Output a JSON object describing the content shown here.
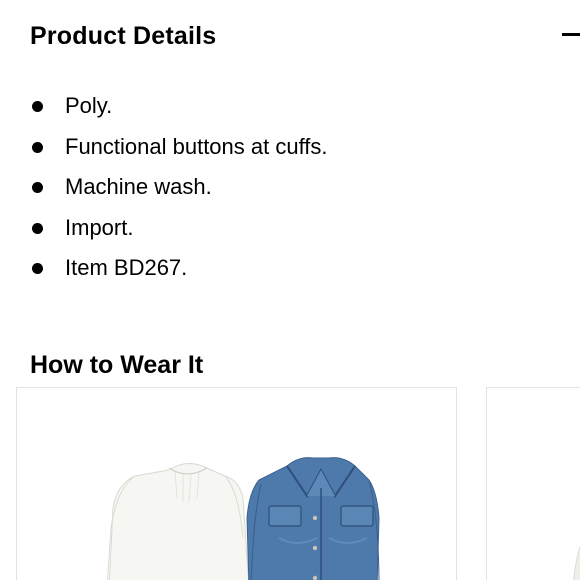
{
  "product_details": {
    "title": "Product Details",
    "toggle_icon": "minus-icon",
    "items": [
      "Poly.",
      "Functional buttons at cuffs.",
      "Machine wash.",
      "Import.",
      "Item BD267."
    ]
  },
  "how_to_wear": {
    "title": "How to Wear It",
    "cards": [
      {
        "items": [
          "white-blouse-image",
          "denim-jacket-image"
        ]
      },
      {
        "items": [
          "partial-garment-image"
        ]
      }
    ]
  }
}
